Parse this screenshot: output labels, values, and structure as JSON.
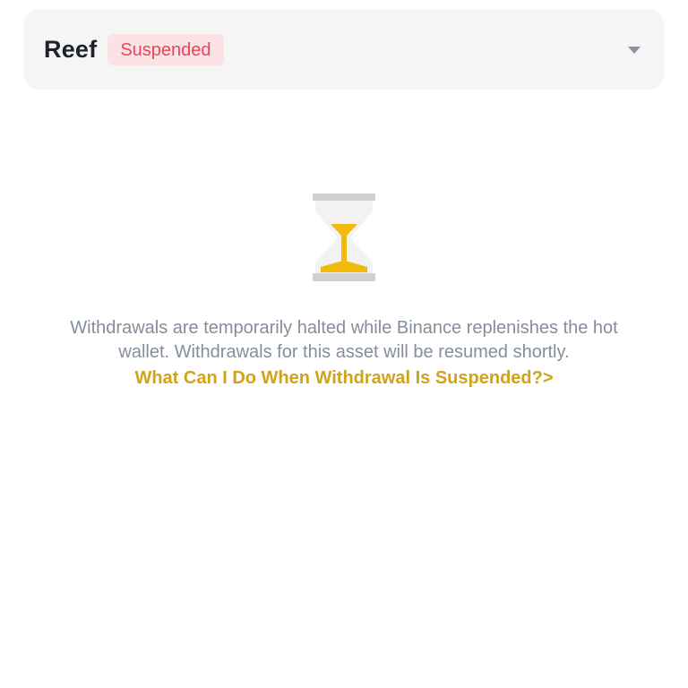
{
  "selector": {
    "asset_name": "Reef",
    "status_label": "Suspended",
    "dropdown_icon": "caret-down-icon"
  },
  "notice": {
    "icon": "hourglass-icon",
    "message_line1": "Withdrawals are temporarily halted while Binance replenishes the hot",
    "message_line2": "wallet. Withdrawals for this asset will be resumed shortly.",
    "help_link": "What Can I Do When Withdrawal Is Suspended?>"
  },
  "colors": {
    "badge_bg": "#fbe3e5",
    "badge_text": "#e8445a",
    "link": "#d0a31a",
    "hourglass_sand": "#f0b90b",
    "hourglass_frame": "#cfd0d2",
    "message_text": "#848e9c"
  }
}
